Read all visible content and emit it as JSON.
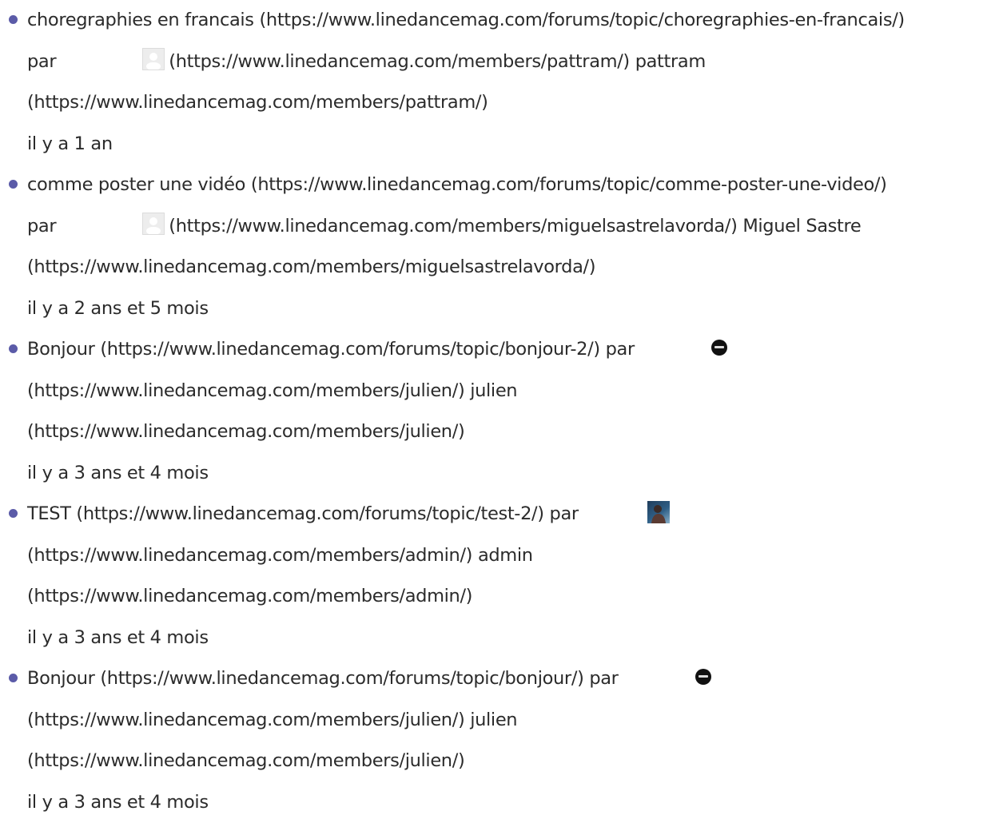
{
  "topics": [
    {
      "title": "choregraphies en francais",
      "topic_url": "(https://www.linedancemag.com/forums/topic/choregraphies-en-francais/)",
      "by": "par",
      "avatar_icon": "default-avatar-icon",
      "member_url": "(https://www.linedancemag.com/members/pattram/)",
      "author": "pattram",
      "member_url_2": "(https://www.linedancemag.com/members/pattram/)",
      "time": "il y a 1 an"
    },
    {
      "title": "comme poster une vidéo",
      "topic_url": "(https://www.linedancemag.com/forums/topic/comme-poster-une-video/)",
      "by": "par",
      "avatar_icon": "default-avatar-icon",
      "member_url": "(https://www.linedancemag.com/members/miguelsastrelavorda/)",
      "author": "Miguel Sastre",
      "member_url_2": "(https://www.linedancemag.com/members/miguelsastrelavorda/)",
      "time": "il y a 2 ans et 5 mois"
    },
    {
      "title": "Bonjour",
      "topic_url": "(https://www.linedancemag.com/forums/topic/bonjour-2/)",
      "by": "par",
      "avatar_icon": "logo-avatar-icon",
      "member_url": "(https://www.linedancemag.com/members/julien/)",
      "author": "julien",
      "member_url_2": "(https://www.linedancemag.com/members/julien/)",
      "time": "il y a 3 ans et 4 mois"
    },
    {
      "title": "TEST",
      "topic_url": "(https://www.linedancemag.com/forums/topic/test-2/)",
      "by": "par",
      "avatar_icon": "photo-avatar-icon",
      "member_url": "(https://www.linedancemag.com/members/admin/)",
      "author": "admin",
      "member_url_2": "(https://www.linedancemag.com/members/admin/)",
      "time": "il y a 3 ans et 4 mois"
    },
    {
      "title": "Bonjour",
      "topic_url": "(https://www.linedancemag.com/forums/topic/bonjour/)",
      "by": "par",
      "avatar_icon": "logo-avatar-icon",
      "member_url": "(https://www.linedancemag.com/members/julien/)",
      "author": "julien",
      "member_url_2": "(https://www.linedancemag.com/members/julien/)",
      "time": "il y a 3 ans et 4 mois"
    }
  ],
  "colors": {
    "text": "#2b2b2b",
    "bullet": "#5b5ba8",
    "background": "#ffffff"
  }
}
